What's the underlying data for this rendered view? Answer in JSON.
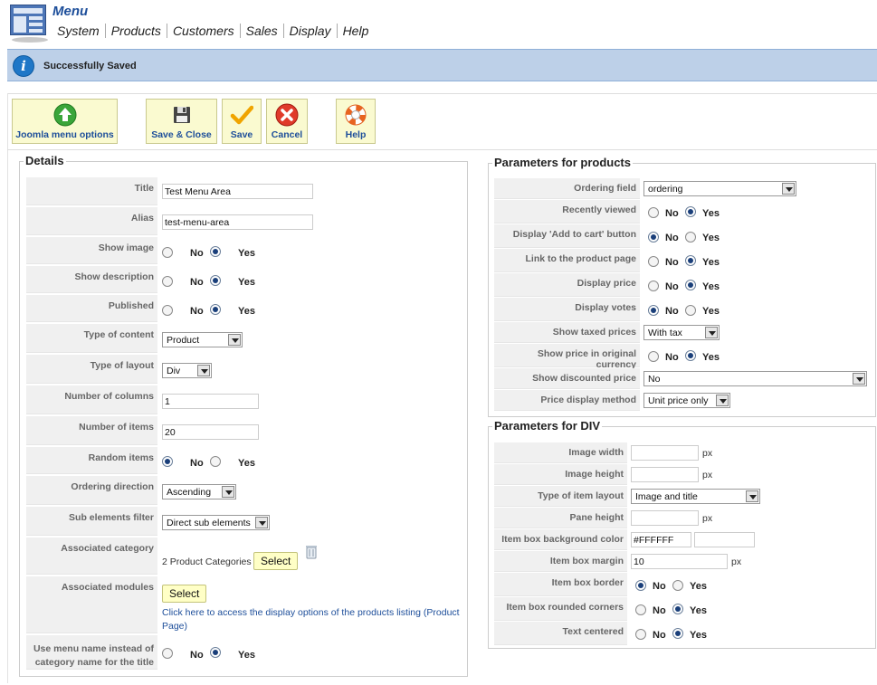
{
  "header": {
    "app_title": "Menu",
    "nav": [
      "System",
      "Products",
      "Customers",
      "Sales",
      "Display",
      "Help"
    ]
  },
  "message": {
    "text": "Successfully Saved",
    "icon": "info-icon"
  },
  "toolbar": {
    "joomla_menu_options": "Joomla menu options",
    "save_close": "Save & Close",
    "save": "Save",
    "cancel": "Cancel",
    "help": "Help"
  },
  "details": {
    "legend": "Details",
    "title_label": "Title",
    "title_value": "Test Menu Area",
    "alias_label": "Alias",
    "alias_value": "test-menu-area",
    "show_image_label": "Show image",
    "show_description_label": "Show description",
    "published_label": "Published",
    "type_of_content_label": "Type of content",
    "type_of_content_value": "Product",
    "type_of_layout_label": "Type of layout",
    "type_of_layout_value": "Div",
    "number_of_columns_label": "Number of columns",
    "number_of_columns_value": "1",
    "number_of_items_label": "Number of items",
    "number_of_items_value": "20",
    "random_items_label": "Random items",
    "ordering_direction_label": "Ordering direction",
    "ordering_direction_value": "Ascending",
    "sub_elements_filter_label": "Sub elements filter",
    "sub_elements_filter_value": "Direct sub elements",
    "associated_category_label": "Associated category",
    "associated_category_value": "2 Product Categories",
    "associated_modules_label": "Associated modules",
    "select_label": "Select",
    "link_text": "Click here to access the display options of the products listing (Product Page)",
    "use_menu_name_label": "Use menu name instead of category name for the title",
    "no": "No",
    "yes": "Yes"
  },
  "products_params": {
    "legend": "Parameters for products",
    "ordering_field_label": "Ordering field",
    "ordering_field_value": "ordering",
    "recently_viewed_label": "Recently viewed",
    "display_add_to_cart_label": "Display 'Add to cart' button",
    "link_to_product_page_label": "Link to the product page",
    "display_price_label": "Display price",
    "display_votes_label": "Display votes",
    "show_taxed_prices_label": "Show taxed prices",
    "show_taxed_prices_value": "With tax",
    "show_price_original_currency_label": "Show price in original currency",
    "show_discounted_price_label": "Show discounted price",
    "show_discounted_price_value": "No",
    "price_display_method_label": "Price display method",
    "price_display_method_value": "Unit price only"
  },
  "div_params": {
    "legend": "Parameters for DIV",
    "image_width_label": "Image width",
    "image_height_label": "Image height",
    "type_of_item_layout_label": "Type of item layout",
    "type_of_item_layout_value": "Image and title",
    "pane_height_label": "Pane height",
    "item_box_bg_color_label": "Item box background color",
    "item_box_bg_color_value": "#FFFFFF",
    "item_box_margin_label": "Item box margin",
    "item_box_margin_value": "10",
    "item_box_border_label": "Item box border",
    "item_box_rounded_corners_label": "Item box rounded corners",
    "text_centered_label": "Text centered",
    "px": "px"
  },
  "radios": {
    "show_image": "yes",
    "show_description": "yes",
    "published": "yes",
    "random_items": "no",
    "use_menu_name": "yes",
    "recently_viewed": "yes",
    "display_add_to_cart": "no",
    "link_to_product_page": "yes",
    "display_price": "yes",
    "display_votes": "no",
    "show_price_original_currency": "yes",
    "item_box_border": "no",
    "item_box_rounded_corners": "yes",
    "text_centered": "yes"
  },
  "colors": {
    "accent": "#1d4e9a",
    "message_bg": "#bdd0e8",
    "toolbar_btn_bg": "#fafad0"
  }
}
